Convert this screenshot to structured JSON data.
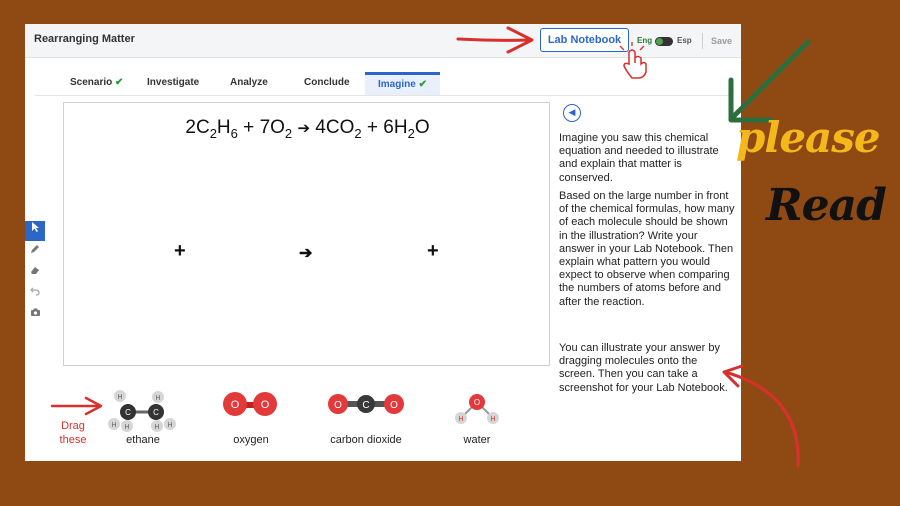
{
  "app": {
    "title": "Rearranging Matter",
    "lab_notebook_label": "Lab Notebook",
    "lang_eng": "Eng",
    "lang_esp": "Esp",
    "save_label": "Save"
  },
  "tabs": [
    {
      "label": "Scenario",
      "completed": true
    },
    {
      "label": "Investigate",
      "completed": false
    },
    {
      "label": "Analyze",
      "completed": false
    },
    {
      "label": "Conclude",
      "completed": false
    },
    {
      "label": "Imagine",
      "completed": true,
      "active": true
    }
  ],
  "check_glyph": "✔",
  "canvas": {
    "equation": {
      "coef_ethane": "2",
      "ethane_c": "C",
      "ethane_c_sub": "2",
      "ethane_h": "H",
      "ethane_h_sub": "6",
      "plus": "+",
      "coef_oxygen": "7",
      "oxygen_o": "O",
      "oxygen_o_sub": "2",
      "arrow": "➔",
      "coef_co2": "4",
      "co2_formula": "CO",
      "co2_sub": "2",
      "coef_water": "6",
      "water_h": "H",
      "water_h_sub": "2",
      "water_o": "O"
    },
    "plus_symbol": "+",
    "arrow_symbol": "➔"
  },
  "tools": [
    "select-tool",
    "pencil-tool",
    "eraser-tool",
    "undo-tool",
    "camera-tool"
  ],
  "instructions": [
    "Imagine you saw this chemical equation and needed to illustrate and explain that matter is conserved.",
    "Based on the large number in front of the chemical formulas, how many of each molecule should be shown in the illustration? Write your answer in your Lab Notebook. Then explain what pattern you would expect to observe when comparing the numbers of atoms before and after the reaction.",
    "You can illustrate your answer by dragging molecules onto the screen. Then you can take a screenshot for your Lab Notebook."
  ],
  "molecules": [
    {
      "label": "ethane",
      "atoms": {
        "carbon": "C",
        "hydrogen": "H"
      }
    },
    {
      "label": "oxygen",
      "atoms": {
        "oxygen": "O"
      }
    },
    {
      "label": "carbon dioxide",
      "atoms": {
        "oxygen": "O",
        "carbon": "C"
      }
    },
    {
      "label": "water",
      "atoms": {
        "hydrogen": "H",
        "oxygen": "O"
      }
    }
  ],
  "annotations": {
    "drag_line1": "Drag",
    "drag_line2": "these",
    "please": "please",
    "read": "Read"
  },
  "colors": {
    "background": "#8f4a14",
    "accent": "#2c67c8",
    "annotation_red": "#d8302d",
    "please_yellow": "#f5b81b",
    "arrow_green": "#2d6e3e",
    "oxygen_red": "#e23a3a",
    "carbon_dark": "#3a3a3a",
    "hydrogen_light": "#d6d6d6"
  }
}
